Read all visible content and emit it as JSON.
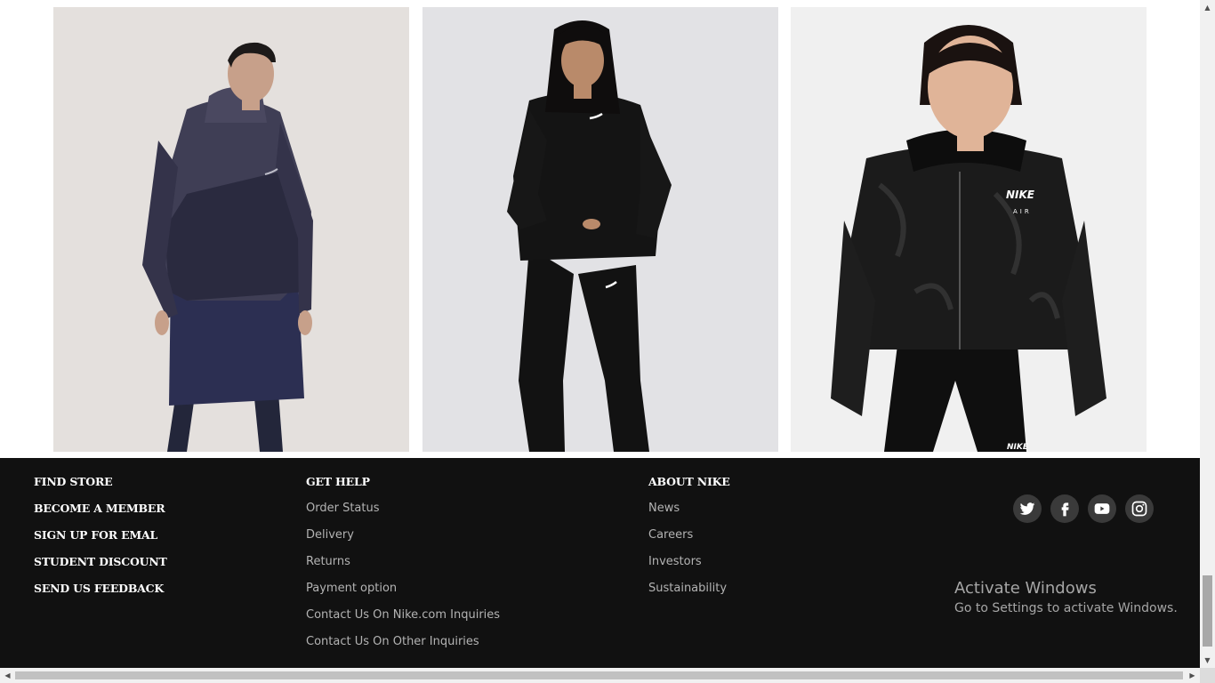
{
  "products": [
    {
      "name": "woman-in-navy-windrunner-jacket",
      "image": "product-photo"
    },
    {
      "name": "woman-in-black-hoodie-and-joggers",
      "image": "product-photo"
    },
    {
      "name": "girl-in-black-velour-nike-air-jacket",
      "image": "product-photo",
      "logo_text": "NIKE",
      "logo_sub": "AIR"
    }
  ],
  "footer": {
    "col1": [
      "FIND STORE",
      "BECOME A MEMBER",
      "SIGN UP FOR EMAL",
      "STUDENT DISCOUNT",
      "SEND US FEEDBACK"
    ],
    "get_help": {
      "heading": "GET HELP",
      "links": [
        "Order Status",
        "Delivery",
        "Returns",
        "Payment option",
        "Contact Us On Nike.com Inquiries",
        "Contact Us On Other Inquiries"
      ]
    },
    "about": {
      "heading": "ABOUT NIKE",
      "links": [
        "News",
        "Careers",
        "Investors",
        "Sustainability"
      ]
    },
    "social": [
      "twitter-icon",
      "facebook-icon",
      "youtube-icon",
      "instagram-icon"
    ],
    "colors": {
      "background": "#111111",
      "heading": "#ffffff",
      "link": "#b3b3b3",
      "icon_bg": "#3a3a3a"
    }
  },
  "watermark": {
    "title": "Activate Windows",
    "subtitle": "Go to Settings to activate Windows."
  }
}
